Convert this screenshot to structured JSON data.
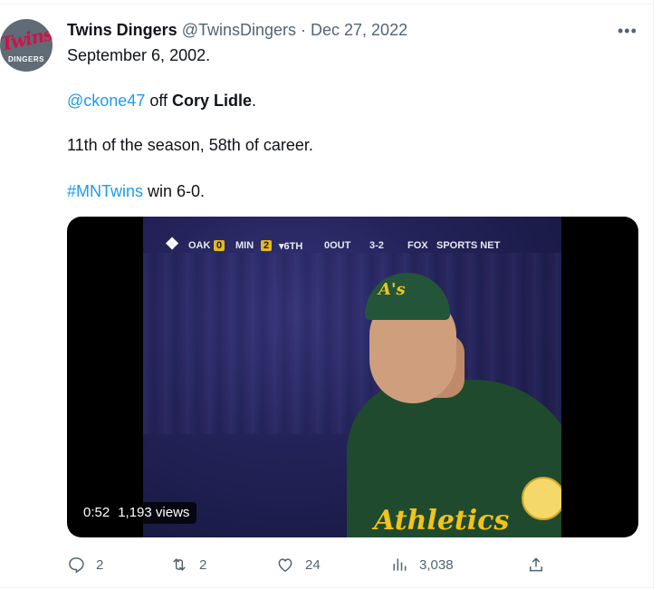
{
  "tweet": {
    "author_name": "Twins Dingers",
    "author_handle": "@TwinsDingers",
    "separator": " · ",
    "date": "Dec 27, 2022",
    "avatar": {
      "logo_text": "Twins",
      "subtext": "DINGERS"
    },
    "more_icon": "more-horizontal-icon",
    "line1": "September 6, 2002.",
    "line2": {
      "mention": "@ckone47",
      "middle": " off ",
      "player": "Cory Lidle",
      "end": "."
    },
    "line3": "11th of the season, 58th of career.",
    "line4": {
      "hashtag": "#MNTwins",
      "rest": " win 6-0."
    }
  },
  "media": {
    "duration": "0:52",
    "views": "1,193 views",
    "scorebug": {
      "team1": "OAK",
      "score1": "0",
      "team2": "MIN",
      "score2": "2",
      "inning": "▾6TH",
      "outs": "0OUT",
      "count": "3-2",
      "network_a": "FOX",
      "network_b": "SPORTS NET"
    },
    "cap_logo": "A's",
    "jersey_text": "Athletics"
  },
  "actions": {
    "reply": {
      "icon": "reply-icon",
      "count": "2"
    },
    "retweet": {
      "icon": "retweet-icon",
      "count": "2"
    },
    "like": {
      "icon": "heart-icon",
      "count": "24"
    },
    "views": {
      "icon": "analytics-icon",
      "count": "3,038"
    },
    "share": {
      "icon": "share-icon"
    }
  },
  "colors": {
    "link": "#1d9bf0",
    "secondary_text": "#536471",
    "primary_text": "#0f1419"
  }
}
